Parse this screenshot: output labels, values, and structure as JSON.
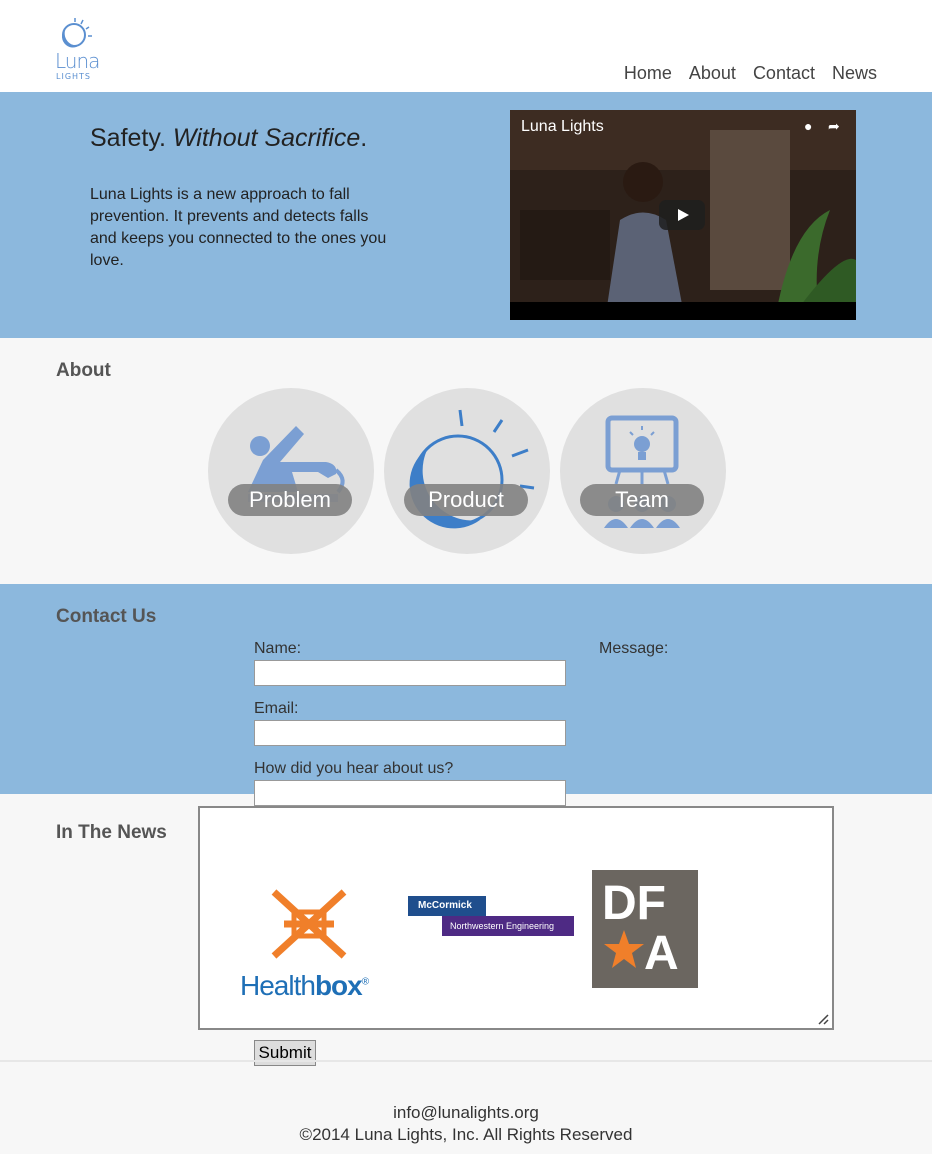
{
  "header": {
    "logo_word": "Luna",
    "logo_sub": "LIGHTS",
    "nav": [
      "Home",
      "About",
      "Contact",
      "News"
    ]
  },
  "hero": {
    "title_plain": "Safety. ",
    "title_italic": "Without Sacrifice",
    "title_end": ".",
    "text": "Luna Lights is a new approach to fall prevention. It prevents and detects falls and keeps you connected to the ones you love.",
    "video_title": "Luna Lights"
  },
  "about": {
    "title": "About",
    "cards": [
      {
        "label": "Problem",
        "icon": "person-falling-icon"
      },
      {
        "label": "Product",
        "icon": "light-bulb-icon"
      },
      {
        "label": "Team",
        "icon": "team-icon"
      }
    ]
  },
  "contact": {
    "title": "Contact Us",
    "name_label": "Name:",
    "email_label": "Email:",
    "hear_label": "How did you hear about us?",
    "message_label": "Message:",
    "name_value": "",
    "email_value": "",
    "hear_value": "",
    "submit_label": "Submit"
  },
  "news": {
    "title": "In The News",
    "logos": [
      {
        "name": "Healthbox",
        "text_a": "Health",
        "text_b": "box",
        "mark": "®"
      },
      {
        "name": "McCormick",
        "text_a": "McCormick",
        "text_b": "Northwestern Engineering"
      },
      {
        "name": "DFA",
        "text_a": "DF",
        "text_b": "A"
      }
    ]
  },
  "footer": {
    "email": "info@lunalights.org",
    "copyright": "©2014 Luna Lights, Inc. All Rights Reserved"
  },
  "colors": {
    "accent": "#8cb8dd",
    "icon_blue": "#5b8fd0",
    "logo_orange": "#f07f2a",
    "logo_blue": "#1e6fb6",
    "mccormick_blue": "#1f4e8d",
    "mccormick_purple": "#4e2a84",
    "dfa_gray": "#6b6660"
  }
}
